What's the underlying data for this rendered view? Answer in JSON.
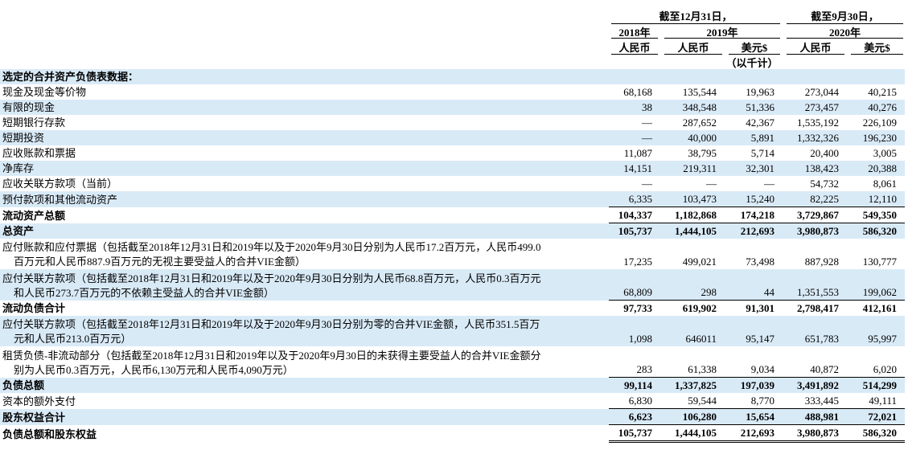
{
  "header": {
    "group_2019": "截至12月31日，",
    "group_2020": "截至9月30日，",
    "year_2018": "2018年",
    "year_2019": "2019年",
    "year_2020": "2020年",
    "col_rmb_2018": "人民币",
    "col_rmb_2019": "人民币",
    "col_usd_2019": "美元$",
    "col_rmb_2020": "人民币",
    "col_usd_2020": "美元$",
    "unit_note": "（以千计）"
  },
  "section_title": "选定的合并资产负债表数据：",
  "rows": [
    {
      "label": "现金及现金等价物",
      "v": [
        "68,168",
        "135,544",
        "19,963",
        "273,044",
        "40,215"
      ]
    },
    {
      "label": "有限的现金",
      "v": [
        "38",
        "348,548",
        "51,336",
        "273,457",
        "40,276"
      ]
    },
    {
      "label": "短期银行存款",
      "v": [
        "—",
        "287,652",
        "42,367",
        "1,535,192",
        "226,109"
      ]
    },
    {
      "label": "短期投资",
      "v": [
        "—",
        "40,000",
        "5,891",
        "1,332,326",
        "196,230"
      ]
    },
    {
      "label": "应收账款和票据",
      "v": [
        "11,087",
        "38,795",
        "5,714",
        "20,400",
        "3,005"
      ]
    },
    {
      "label": "净库存",
      "v": [
        "14,151",
        "219,311",
        "32,301",
        "138,423",
        "20,388"
      ]
    },
    {
      "label": "应收关联方款项（当前）",
      "v": [
        "—",
        "—",
        "—",
        "54,732",
        "8,061"
      ]
    },
    {
      "label": "预付款项和其他流动资产",
      "v": [
        "6,335",
        "103,473",
        "15,240",
        "82,225",
        "12,110"
      ]
    },
    {
      "label": "流动资产总额",
      "v": [
        "104,337",
        "1,182,868",
        "174,218",
        "3,729,867",
        "549,350"
      ]
    },
    {
      "label": "总资产",
      "v": [
        "105,737",
        "1,444,105",
        "212,693",
        "3,980,873",
        "586,320"
      ]
    },
    {
      "label": "应付账款和应付票据（包括截至2018年12月31日和2019年以及于2020年9月30日分别为人民币17.2百万元，人民币499.0",
      "label2": "百万元和人民币887.9百万元的无视主要受益人的合并VIE金额）",
      "v": [
        "17,235",
        "499,021",
        "73,498",
        "887,928",
        "130,777"
      ]
    },
    {
      "label": "应付关联方款项（包括截至2018年12月31日和2019年以及于2020年9月30日分别为人民币68.8百万元，人民币0.3百万元",
      "label2": "和人民币273.7百万元的不依赖主受益人的合并VIE金额）",
      "v": [
        "68,809",
        "298",
        "44",
        "1,351,553",
        "199,062"
      ]
    },
    {
      "label": "流动负债合计",
      "v": [
        "97,733",
        "619,902",
        "91,301",
        "2,798,417",
        "412,161"
      ]
    },
    {
      "label": "应付关联方款项（包括截至2018年12月31日和2019年以及于2020年9月30日分别为零的合并VIE金额，人民币351.5百万",
      "label2": "元和人民币213.0百万元）",
      "v": [
        "1,098",
        "646011",
        "95,147",
        "651,783",
        "95,997"
      ]
    },
    {
      "label": "租赁负债-非流动部分（包括截至2018年12月31日和2019年以及于2020年9月30日的未获得主要受益人的合并VIE金额分",
      "label2": "别为人民币0.3百万元，人民币6,130万元和人民币4,090万元）",
      "v": [
        "283",
        "61,338",
        "9,034",
        "40,872",
        "6,020"
      ]
    },
    {
      "label": "负债总额",
      "v": [
        "99,114",
        "1,337,825",
        "197,039",
        "3,491,892",
        "514,299"
      ]
    },
    {
      "label": "资本的额外支付",
      "v": [
        "6,830",
        "59,544",
        "8,770",
        "333,445",
        "49,111"
      ]
    },
    {
      "label": "股东权益合计",
      "v": [
        "6,623",
        "106,280",
        "15,654",
        "488,981",
        "72,021"
      ]
    },
    {
      "label": "负债总额和股东权益",
      "v": [
        "105,737",
        "1,444,105",
        "212,693",
        "3,980,873",
        "586,320"
      ]
    }
  ],
  "colors": {
    "row_shade": "#d9eaf7"
  }
}
